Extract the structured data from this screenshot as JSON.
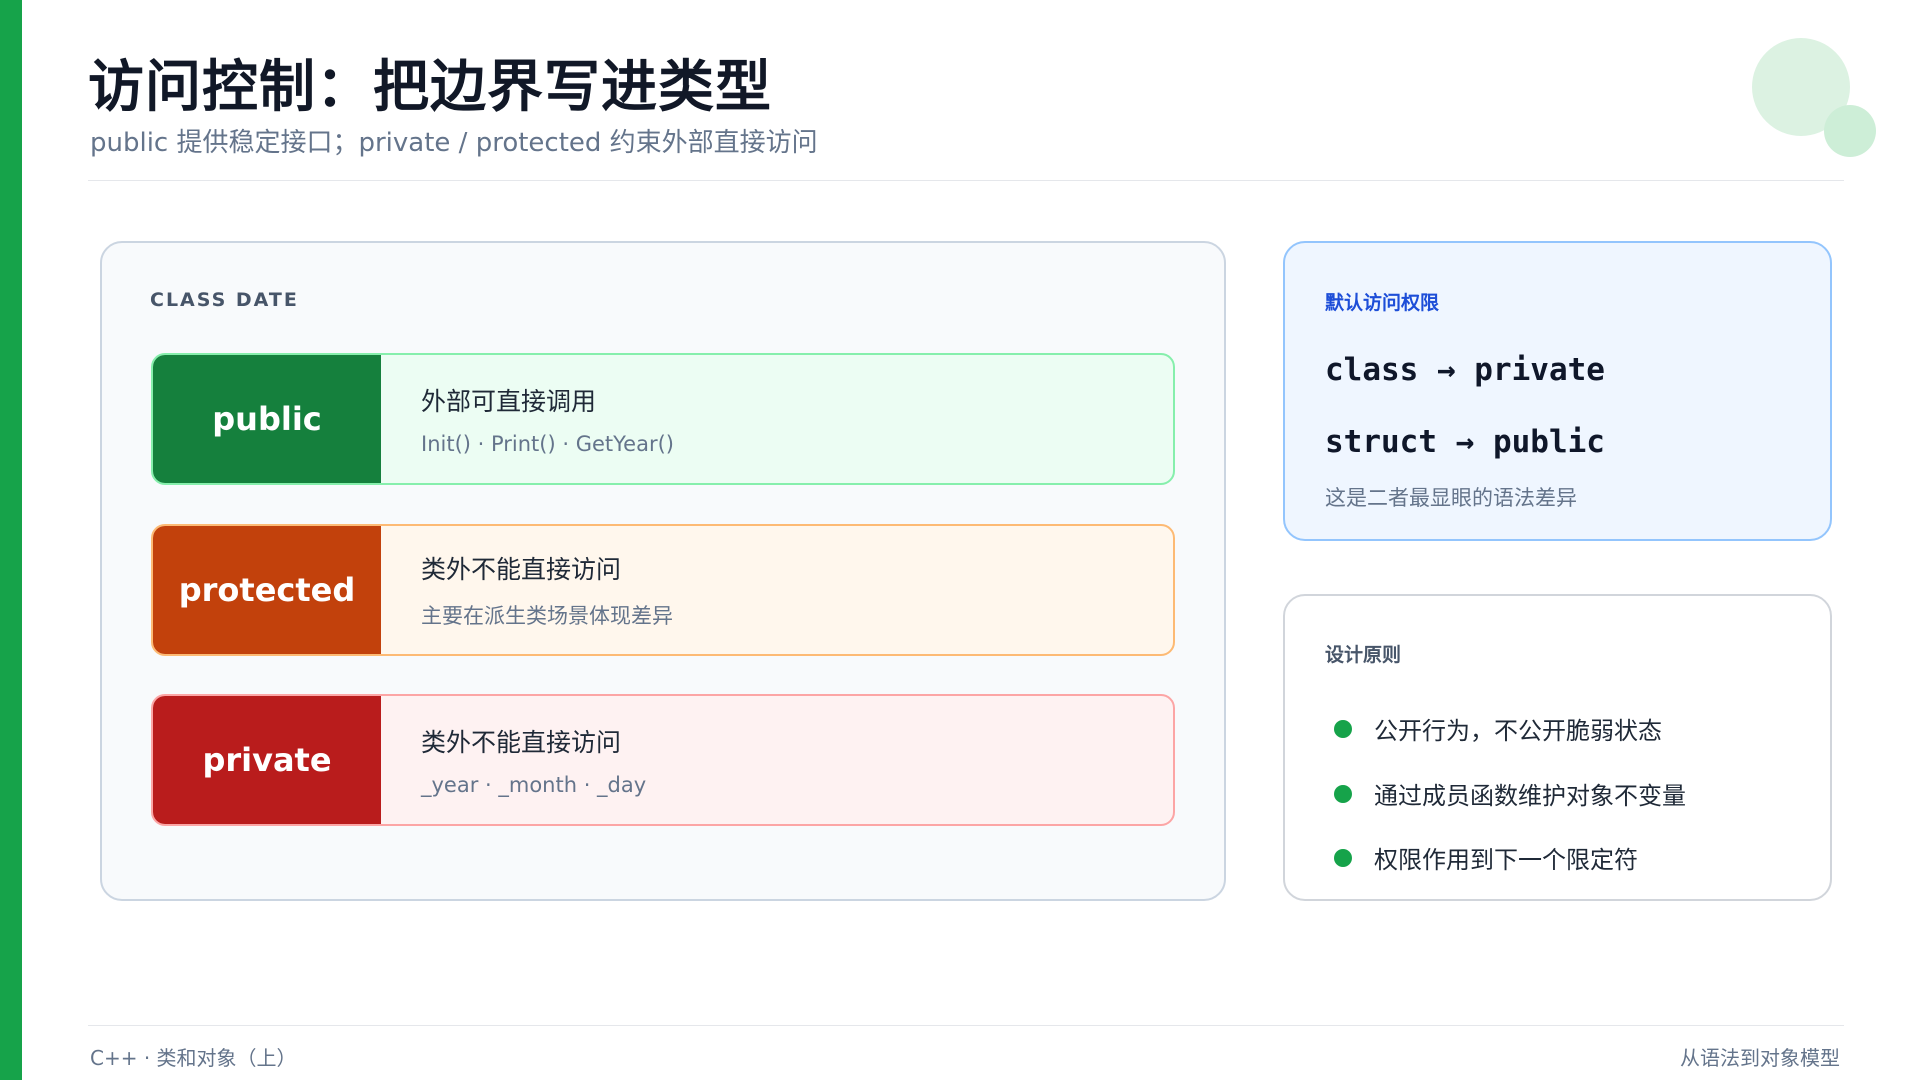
{
  "header": {
    "title": "访问控制：把边界写进类型",
    "subtitle": "public 提供稳定接口；private / protected 约束外部直接访问"
  },
  "class_card": {
    "label": "CLASS DATE",
    "rows": [
      {
        "tag": "public",
        "description": "外部可直接调用",
        "detail": "Init() · Print() · GetYear()"
      },
      {
        "tag": "protected",
        "description": "类外不能直接访问",
        "detail": "主要在派生类场景体现差异"
      },
      {
        "tag": "private",
        "description": "类外不能直接访问",
        "detail": "_year · _month · _day"
      }
    ]
  },
  "default_access": {
    "title": "默认访问权限",
    "lines": [
      "class → private",
      "struct → public"
    ],
    "note": "这是二者最显眼的语法差异"
  },
  "principles": {
    "title": "设计原则",
    "items": [
      "公开行为，不公开脆弱状态",
      "通过成员函数维护对象不变量",
      "权限作用到下一个限定符"
    ]
  },
  "footer": {
    "left": "C++ · 类和对象（上）",
    "right": "从语法到对象模型"
  },
  "colors": {
    "accent": "#16a34a",
    "public": "#15803d",
    "protected": "#c2410c",
    "private": "#b91c1c",
    "info": "#1d4ed8"
  }
}
